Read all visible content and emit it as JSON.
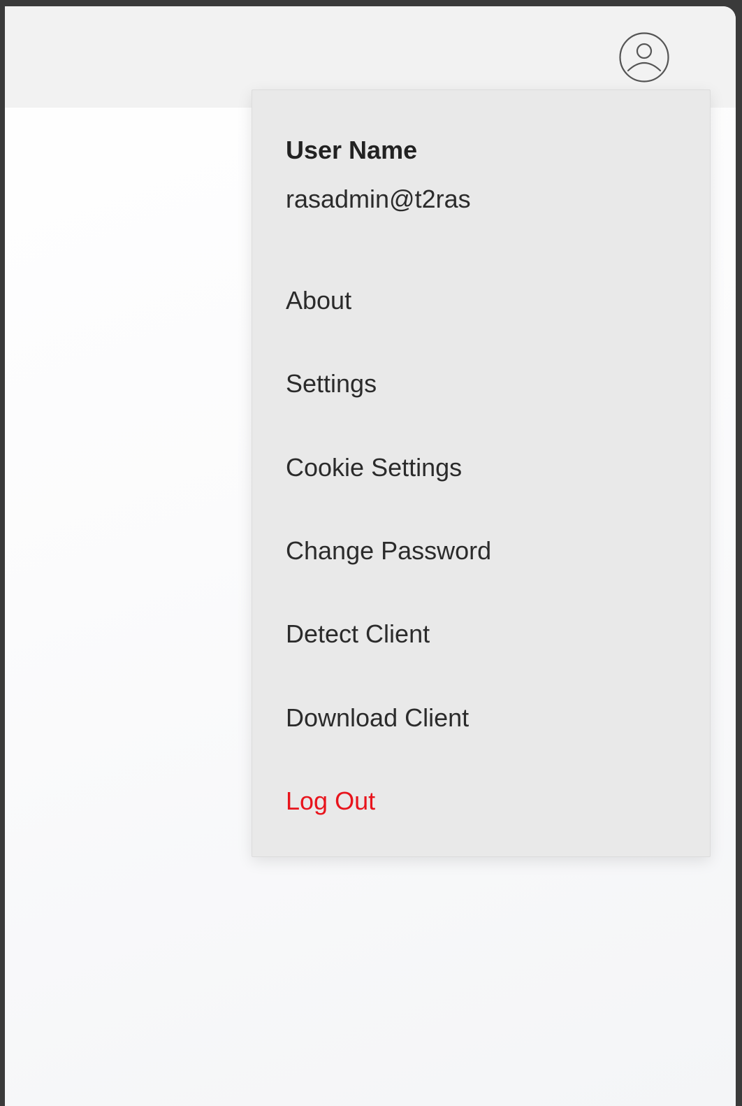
{
  "header": {
    "avatar_icon": "user-circle-icon"
  },
  "dropdown": {
    "user_label": "User Name",
    "user_value": "rasadmin@t2ras",
    "items": [
      {
        "label": "About"
      },
      {
        "label": "Settings"
      },
      {
        "label": "Cookie Settings"
      },
      {
        "label": "Change Password"
      },
      {
        "label": "Detect Client"
      },
      {
        "label": "Download Client"
      },
      {
        "label": "Log Out",
        "color": "#e8141c"
      }
    ]
  },
  "colors": {
    "topbar": "#f2f2f2",
    "dropdown_bg": "#e9e9e9",
    "text": "#2b2b2b",
    "danger": "#e8141c"
  }
}
